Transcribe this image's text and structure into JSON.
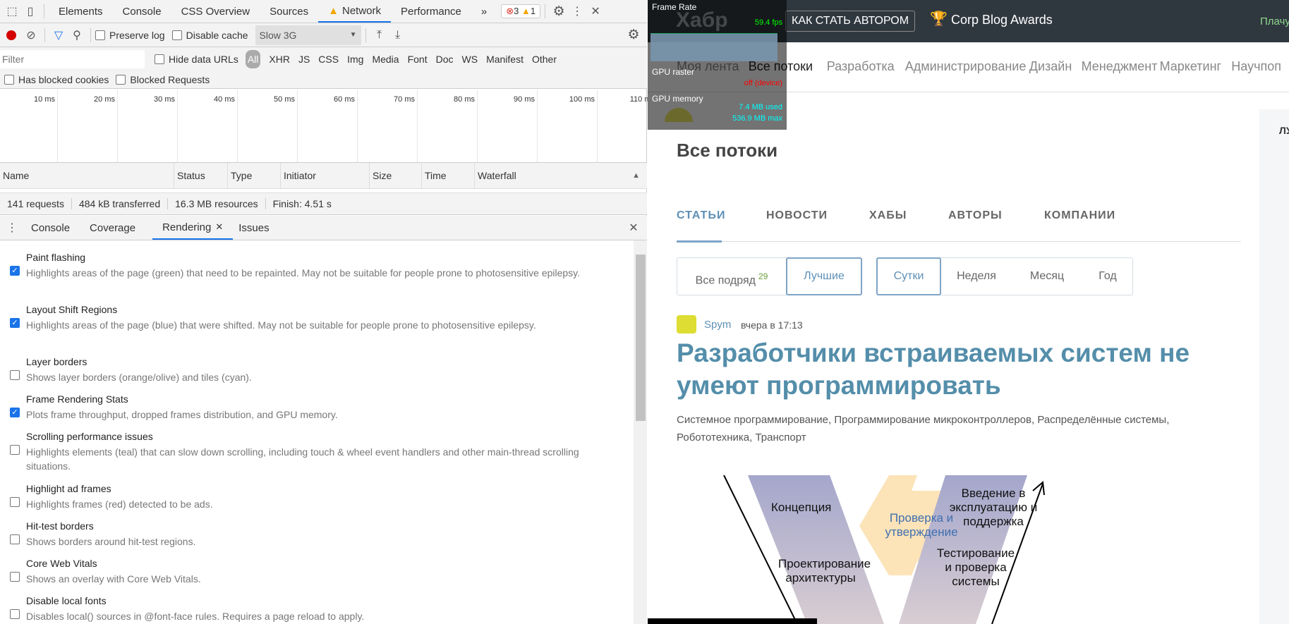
{
  "devtools": {
    "tabs": [
      "Elements",
      "Console",
      "CSS Overview",
      "Sources",
      "Network",
      "Performance"
    ],
    "more": "»",
    "errors": "3",
    "warnings": "1",
    "toolbar": {
      "preserve_log": "Preserve log",
      "disable_cache": "Disable cache",
      "throttle": "Slow 3G"
    },
    "filter": {
      "placeholder": "Filter",
      "hide_data_urls": "Hide data URLs",
      "types": [
        "All",
        "XHR",
        "JS",
        "CSS",
        "Img",
        "Media",
        "Font",
        "Doc",
        "WS",
        "Manifest",
        "Other"
      ],
      "blocked_cookies": "Has blocked cookies",
      "blocked_requests": "Blocked Requests"
    },
    "ticks": [
      "10 ms",
      "20 ms",
      "30 ms",
      "40 ms",
      "50 ms",
      "60 ms",
      "70 ms",
      "80 ms",
      "90 ms",
      "100 ms",
      "110 ms"
    ],
    "columns": [
      "Name",
      "Status",
      "Type",
      "Initiator",
      "Size",
      "Time",
      "Waterfall"
    ],
    "status": {
      "requests": "141 requests",
      "transferred": "484 kB transferred",
      "resources": "16.3 MB resources",
      "finish": "Finish: 4.51 s"
    },
    "drawer_tabs": [
      "Console",
      "Coverage",
      "Rendering",
      "Issues"
    ],
    "rendering": [
      {
        "title": "Paint flashing",
        "desc": "Highlights areas of the page (green) that need to be repainted. May not be suitable for people prone to photosensitive epilepsy.",
        "checked": true
      },
      {
        "title": "Layout Shift Regions",
        "desc": "Highlights areas of the page (blue) that were shifted. May not be suitable for people prone to photosensitive epilepsy.",
        "checked": true
      },
      {
        "title": "Layer borders",
        "desc": "Shows layer borders (orange/olive) and tiles (cyan).",
        "checked": false
      },
      {
        "title": "Frame Rendering Stats",
        "desc": "Plots frame throughput, dropped frames distribution, and GPU memory.",
        "checked": true
      },
      {
        "title": "Scrolling performance issues",
        "desc": "Highlights elements (teal) that can slow down scrolling, including touch & wheel event handlers and other main-thread scrolling situations.",
        "checked": false
      },
      {
        "title": "Highlight ad frames",
        "desc": "Highlights frames (red) detected to be ads.",
        "checked": false
      },
      {
        "title": "Hit-test borders",
        "desc": "Shows borders around hit-test regions.",
        "checked": false
      },
      {
        "title": "Core Web Vitals",
        "desc": "Shows an overlay with Core Web Vitals.",
        "checked": false
      },
      {
        "title": "Disable local fonts",
        "desc": "Disables local() sources in @font-face rules. Requires a page reload to apply.",
        "checked": false
      },
      {
        "title": "Emulate a focused page",
        "desc": "",
        "checked": false
      }
    ]
  },
  "fps_meter": {
    "frame_rate": "Frame Rate",
    "fps": "59.4 fps",
    "gpu_raster": "GPU raster",
    "raster_status": "off (device)",
    "gpu_memory": "GPU memory",
    "used": "7.4 MB used",
    "max": "536.9 MB max"
  },
  "site": {
    "logo": "Хабр",
    "become_author": "КАК СТАТЬ АВТОРОМ",
    "awards": "Corp Blog Awards",
    "header_right": "Плачу",
    "nav": [
      "Моя лента",
      "Все потоки",
      "Разработка",
      "Администрирование",
      "Дизайн",
      "Менеджмент",
      "Маркетинг",
      "Научпоп"
    ],
    "page_title": "Все потоки",
    "tabs": [
      "СТАТЬИ",
      "НОВОСТИ",
      "ХАБЫ",
      "АВТОРЫ",
      "КОМПАНИИ"
    ],
    "filter1": {
      "all": "Все подряд",
      "count": "29",
      "best": "Лучшие"
    },
    "filter2": [
      "Сутки",
      "Неделя",
      "Месяц",
      "Год"
    ],
    "author": "Spym",
    "time": "вчера в 17:13",
    "headline": "Разработчики встраиваемых систем не умеют программировать",
    "hubs": "Системное программирование,  Программирование микроконтроллеров,  Распределённые системы,  Робототехника,  Транспорт",
    "sidebar_title": "ЛУ",
    "diagram": {
      "concept": "Концепция",
      "arch": "Проектирование архитектуры",
      "verify": "Проверка и утверждение",
      "deploy": "Введение в эксплуатацию и поддержка",
      "test": "Тестирование и проверка системы"
    }
  }
}
